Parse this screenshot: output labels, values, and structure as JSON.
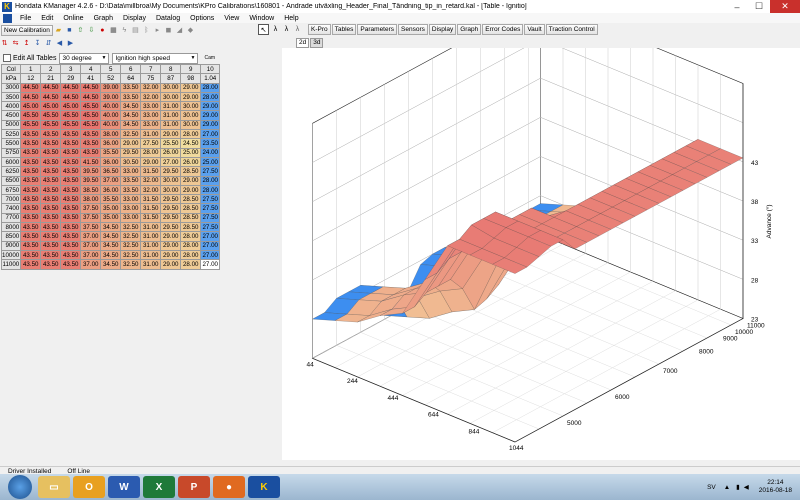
{
  "window": {
    "title": "Hondata KManager 4.2.6 - D:\\Data\\millbroa\\My Documents\\KPro Calibrations\\160801 - Ändrade utväxling_Header_Final_Tändning_tip_in_retard.kal - [Table - Ignitio]",
    "minimize": "–",
    "maximize": "☐",
    "close": "✕"
  },
  "menu": [
    "File",
    "Edit",
    "Online",
    "Graph",
    "Display",
    "Datalog",
    "Options",
    "View",
    "Window",
    "Help"
  ],
  "toolbar": {
    "new_calibration": "New Calibration",
    "right_buttons": [
      "K-Pro",
      "Tables",
      "Parameters",
      "Sensors",
      "Display",
      "Graph",
      "Error Codes",
      "Vault",
      "Traction Control"
    ]
  },
  "table_controls": {
    "edit_all_label": "Edit All Tables",
    "degree_select": "30 degree",
    "table_select": "Ignition high speed",
    "cam_label": "Cam"
  },
  "view_tabs": [
    "2d",
    "3d"
  ],
  "grid": {
    "col_label": "Col",
    "kpa_label": "kPa",
    "col_numbers": [
      "1",
      "2",
      "3",
      "4",
      "5",
      "6",
      "7",
      "8",
      "9",
      "10"
    ],
    "kpa_values": [
      "12",
      "21",
      "29",
      "41",
      "52",
      "64",
      "75",
      "87",
      "98",
      "1.04"
    ],
    "rows": [
      {
        "rpm": "3000",
        "v": [
          "44.50",
          "44.50",
          "44.50",
          "44.50",
          "39.00",
          "33.50",
          "32.00",
          "30.00",
          "29.00",
          "28.00"
        ]
      },
      {
        "rpm": "3500",
        "v": [
          "44.50",
          "44.50",
          "44.50",
          "44.50",
          "39.00",
          "33.50",
          "32.00",
          "30.00",
          "29.00",
          "28.00"
        ]
      },
      {
        "rpm": "4000",
        "v": [
          "45.00",
          "45.00",
          "45.00",
          "45.50",
          "40.00",
          "34.50",
          "33.00",
          "31.00",
          "30.00",
          "29.00"
        ]
      },
      {
        "rpm": "4500",
        "v": [
          "45.50",
          "45.50",
          "45.50",
          "45.50",
          "40.00",
          "34.50",
          "33.00",
          "31.00",
          "30.00",
          "29.00"
        ]
      },
      {
        "rpm": "5000",
        "v": [
          "45.50",
          "45.50",
          "45.50",
          "45.50",
          "40.00",
          "34.50",
          "33.00",
          "31.00",
          "30.00",
          "29.00"
        ]
      },
      {
        "rpm": "5250",
        "v": [
          "43.50",
          "43.50",
          "43.50",
          "43.50",
          "38.00",
          "32.50",
          "31.00",
          "29.00",
          "28.00",
          "27.00"
        ]
      },
      {
        "rpm": "5500",
        "v": [
          "43.50",
          "43.50",
          "43.50",
          "43.50",
          "36.00",
          "29.00",
          "27.50",
          "25.50",
          "24.50",
          "23.50"
        ]
      },
      {
        "rpm": "5750",
        "v": [
          "43.50",
          "43.50",
          "43.50",
          "43.50",
          "35.50",
          "29.50",
          "28.00",
          "26.00",
          "25.00",
          "24.00"
        ]
      },
      {
        "rpm": "6000",
        "v": [
          "43.50",
          "43.50",
          "43.50",
          "41.50",
          "36.00",
          "30.50",
          "29.00",
          "27.00",
          "26.00",
          "25.00"
        ]
      },
      {
        "rpm": "6250",
        "v": [
          "43.50",
          "43.50",
          "43.50",
          "39.50",
          "36.50",
          "33.00",
          "31.50",
          "29.50",
          "28.50",
          "27.50"
        ]
      },
      {
        "rpm": "6500",
        "v": [
          "43.50",
          "43.50",
          "43.50",
          "39.50",
          "37.00",
          "33.50",
          "32.00",
          "30.00",
          "29.00",
          "28.00"
        ]
      },
      {
        "rpm": "6750",
        "v": [
          "43.50",
          "43.50",
          "43.50",
          "38.50",
          "36.00",
          "33.50",
          "32.00",
          "30.00",
          "29.00",
          "28.00"
        ]
      },
      {
        "rpm": "7000",
        "v": [
          "43.50",
          "43.50",
          "43.50",
          "38.00",
          "35.50",
          "33.00",
          "31.50",
          "29.50",
          "28.50",
          "27.50"
        ]
      },
      {
        "rpm": "7400",
        "v": [
          "43.50",
          "43.50",
          "43.50",
          "37.50",
          "35.00",
          "33.00",
          "31.50",
          "29.50",
          "28.50",
          "27.50"
        ]
      },
      {
        "rpm": "7700",
        "v": [
          "43.50",
          "43.50",
          "43.50",
          "37.50",
          "35.00",
          "33.00",
          "31.50",
          "29.50",
          "28.50",
          "27.50"
        ]
      },
      {
        "rpm": "8000",
        "v": [
          "43.50",
          "43.50",
          "43.50",
          "37.50",
          "34.50",
          "32.50",
          "31.00",
          "29.50",
          "28.50",
          "27.50"
        ]
      },
      {
        "rpm": "8500",
        "v": [
          "43.50",
          "43.50",
          "43.50",
          "37.00",
          "34.50",
          "32.50",
          "31.00",
          "29.00",
          "28.00",
          "27.00"
        ]
      },
      {
        "rpm": "9000",
        "v": [
          "43.50",
          "43.50",
          "43.50",
          "37.00",
          "34.50",
          "32.50",
          "31.00",
          "29.00",
          "28.00",
          "27.00"
        ]
      },
      {
        "rpm": "10000",
        "v": [
          "43.50",
          "43.50",
          "43.50",
          "37.00",
          "34.50",
          "32.50",
          "31.00",
          "29.00",
          "28.00",
          "27.00"
        ]
      },
      {
        "rpm": "11000",
        "v": [
          "43.50",
          "43.50",
          "43.50",
          "37.00",
          "34.50",
          "32.50",
          "31.00",
          "29.00",
          "28.00",
          "27.00"
        ]
      }
    ]
  },
  "colors": {
    "cell_high": "#e8746e",
    "cell_low": "#f0e0a0",
    "last_col": "#5aa0ee",
    "surface_high": "#e87a74",
    "surface_low": "#f2c898",
    "surface_floor": "#3d8ef0"
  },
  "chart3d": {
    "z_axis_label": "Advance (°)",
    "z_ticks": [
      "43",
      "38",
      "33",
      "28",
      "23"
    ],
    "rpm_ticks": [
      "5000",
      "6000",
      "7000",
      "8000",
      "9000",
      "10000",
      "11000"
    ],
    "load_ticks": [
      "44",
      "244",
      "444",
      "644",
      "844",
      "1044"
    ]
  },
  "status": {
    "driver": "Driver Installed",
    "line": "Off Line"
  },
  "taskbar": {
    "apps": [
      "Explorer",
      "Outlook",
      "Word",
      "Excel",
      "PowerPoint",
      "Firefox",
      "KManager"
    ],
    "lang": "SV",
    "time": "22:14",
    "date": "2016-08-18"
  }
}
